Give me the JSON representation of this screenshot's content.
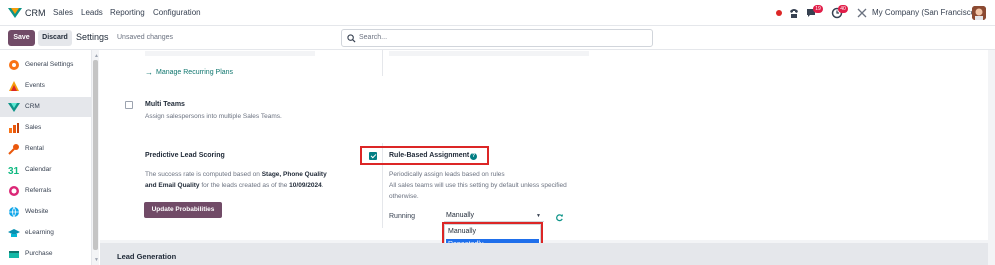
{
  "nav": {
    "app": "CRM",
    "menu": [
      "Sales",
      "Leads",
      "Reporting",
      "Configuration"
    ],
    "chat_badge": "19",
    "activity_badge": "40",
    "company": "My Company (San Francisco)"
  },
  "control": {
    "save_label": "Save",
    "discard_label": "Discard",
    "title": "Settings",
    "unsaved": "Unsaved changes",
    "search_placeholder": "Search..."
  },
  "sidebar": {
    "items": [
      {
        "label": "General Settings",
        "icon": "general-settings-icon",
        "color": "#f97316"
      },
      {
        "label": "Events",
        "icon": "events-icon",
        "color": "#f59e0b"
      },
      {
        "label": "CRM",
        "icon": "crm-icon",
        "color": "#0d9488",
        "active": true
      },
      {
        "label": "Sales",
        "icon": "sales-icon",
        "color": "#f97316"
      },
      {
        "label": "Rental",
        "icon": "rental-icon",
        "color": "#ea580c"
      },
      {
        "label": "Calendar",
        "icon": "calendar-icon",
        "color": "#10b981"
      },
      {
        "label": "Referrals",
        "icon": "referrals-icon",
        "color": "#db2777"
      },
      {
        "label": "Website",
        "icon": "website-icon",
        "color": "#0ea5e9"
      },
      {
        "label": "eLearning",
        "icon": "elearning-icon",
        "color": "#0891b2"
      },
      {
        "label": "Purchase",
        "icon": "purchase-icon",
        "color": "#14b8a6"
      }
    ]
  },
  "settings": {
    "recurring_link": "Manage Recurring Plans",
    "multi_teams": {
      "title": "Multi Teams",
      "desc": "Assign salespersons into multiple Sales Teams."
    },
    "pls": {
      "title": "Predictive Lead Scoring",
      "line1_pre": "The success rate is computed based on ",
      "line1_bold": "Stage, Phone Quality",
      "line2_bold1": "and Email Quality",
      "line2_mid": " for the leads created as of the ",
      "line2_bold2": "10/09/2024",
      "line2_end": ".",
      "button": "Update Probabilities"
    },
    "rba": {
      "title": "Rule-Based Assignment",
      "desc1": "Periodically assign leads based on rules",
      "desc2": "All sales teams will use this setting by default unless specified",
      "desc3": "otherwise.",
      "running_label": "Running",
      "select_value": "Manually",
      "options": [
        "Manually",
        "Repeatedly"
      ],
      "selected_option": "Repeatedly"
    },
    "section": "Lead Generation"
  },
  "colors": {
    "brand": "#714b67",
    "accent": "#017e84",
    "highlight": "#dc2626",
    "selected": "#1f6feb"
  }
}
